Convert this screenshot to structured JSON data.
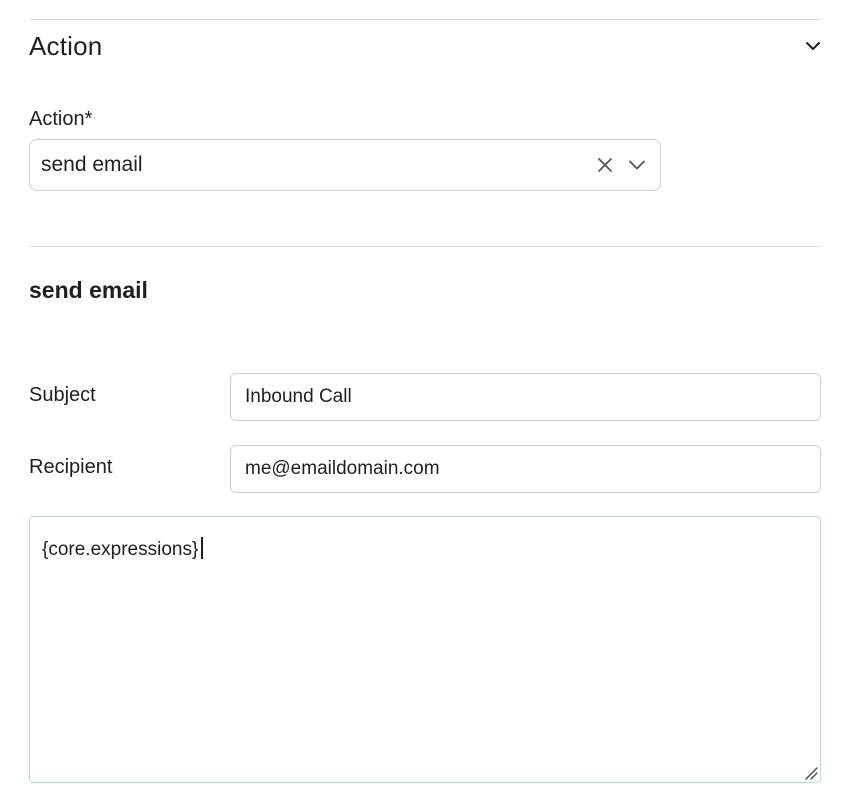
{
  "section": {
    "title": "Action",
    "collapse_icon": "chevron-down-icon"
  },
  "action_field": {
    "label": "Action*",
    "selected_value": "send email",
    "clear_icon": "close-icon",
    "dropdown_icon": "chevron-down-icon"
  },
  "send_email": {
    "title": "send email",
    "subject": {
      "label": "Subject",
      "value": "Inbound Call"
    },
    "recipient": {
      "label": "Recipient",
      "value": "me@emaildomain.com"
    },
    "body": {
      "value": "{core.expressions}"
    }
  },
  "colors": {
    "text": "#1f1f1f",
    "border": "#cfcfcf",
    "divider": "#d9d9d9",
    "focus_border": "#b9d9e2"
  }
}
